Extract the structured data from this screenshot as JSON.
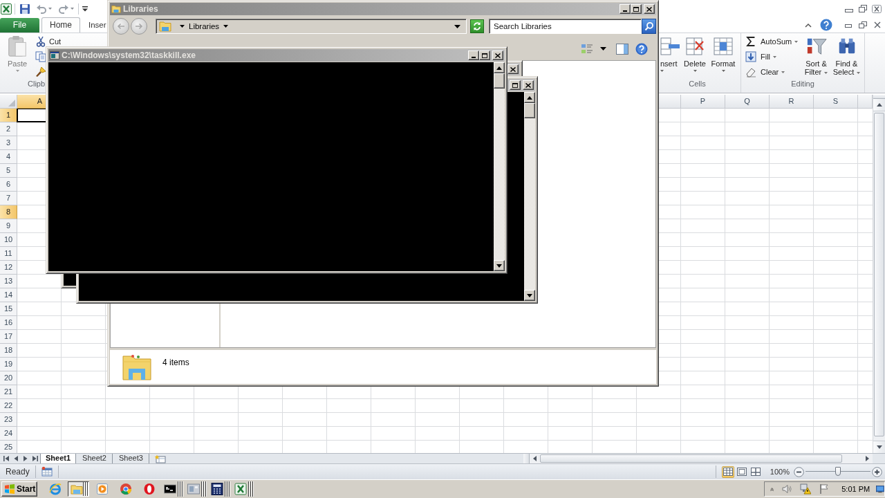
{
  "excel": {
    "ribbon_tabs": [
      {
        "label": "File",
        "kind": "backstage",
        "selected": false
      },
      {
        "label": "Home",
        "kind": "tab",
        "selected": true
      },
      {
        "label": "Inser",
        "kind": "tab",
        "selected": false
      }
    ],
    "clipboard_group": {
      "paste": "Paste",
      "cut": "Cut",
      "label": "Clipb"
    },
    "cells_group": {
      "buttons": [
        "nsert",
        "Delete",
        "Format"
      ],
      "label": "Cells"
    },
    "editing_group": {
      "small_buttons": [
        "AutoSum",
        "Fill",
        "Clear"
      ],
      "large_buttons": [
        "Sort & Filter",
        "Find & Select"
      ],
      "label": "Editing"
    },
    "columns_left": [
      {
        "label": "A",
        "selected": true
      }
    ],
    "columns_right": [
      {
        "label": "P",
        "selected": false
      },
      {
        "label": "Q",
        "selected": false
      },
      {
        "label": "R",
        "selected": false
      },
      {
        "label": "S",
        "selected": false
      }
    ],
    "rows": [
      {
        "label": "1",
        "selected": true
      },
      {
        "label": "2",
        "selected": false
      },
      {
        "label": "3",
        "selected": false
      },
      {
        "label": "4",
        "selected": false
      },
      {
        "label": "5",
        "selected": false
      },
      {
        "label": "6",
        "selected": false
      },
      {
        "label": "7",
        "selected": false
      },
      {
        "label": "8",
        "selected": true
      },
      {
        "label": "9",
        "selected": false
      },
      {
        "label": "10",
        "selected": false
      },
      {
        "label": "11",
        "selected": false
      },
      {
        "label": "12",
        "selected": false
      },
      {
        "label": "13",
        "selected": false
      },
      {
        "label": "14",
        "selected": false
      },
      {
        "label": "15",
        "selected": false
      },
      {
        "label": "16",
        "selected": false
      },
      {
        "label": "17",
        "selected": false
      },
      {
        "label": "18",
        "selected": false
      },
      {
        "label": "19",
        "selected": false
      },
      {
        "label": "20",
        "selected": false
      },
      {
        "label": "21",
        "selected": false
      },
      {
        "label": "22",
        "selected": false
      },
      {
        "label": "23",
        "selected": false
      },
      {
        "label": "24",
        "selected": false
      },
      {
        "label": "25",
        "selected": false
      }
    ],
    "sheet_tabs": [
      {
        "label": "Sheet1",
        "selected": true
      },
      {
        "label": "Sheet2",
        "selected": false
      },
      {
        "label": "Sheet3",
        "selected": false
      }
    ],
    "status": "Ready",
    "views": [
      {
        "kind": "normal",
        "selected": true
      },
      {
        "kind": "page_layout",
        "selected": false
      },
      {
        "kind": "page_break_preview",
        "selected": false
      }
    ],
    "zoom": {
      "reading": "100%",
      "level": 0.5
    }
  },
  "windows": [
    {
      "kind": "explorer",
      "title": "Libraries",
      "breadcrumb": "Libraries",
      "search": {
        "placeholder": "Search Libraries"
      },
      "details": "4 items"
    },
    {
      "kind": "console"
    },
    {
      "kind": "console"
    },
    {
      "kind": "console",
      "title": "C:\\Windows\\system32\\taskkill.exe"
    }
  ],
  "taskbar": {
    "start": "Start",
    "apps": [
      {
        "kind": "ie",
        "selected": false,
        "stacked": false
      },
      {
        "kind": "explorer",
        "selected": true,
        "stacked": true
      },
      {
        "kind": "media",
        "selected": false,
        "stacked": false
      },
      {
        "kind": "chrome",
        "selected": false,
        "stacked": false
      },
      {
        "kind": "opera",
        "selected": false,
        "stacked": false
      },
      {
        "kind": "console",
        "selected": false,
        "stacked": true
      },
      {
        "kind": "window",
        "selected": false,
        "stacked": true
      },
      {
        "kind": "calculator",
        "selected": false,
        "stacked": true
      },
      {
        "kind": "excel",
        "selected": false,
        "stacked": true
      }
    ],
    "clock": "5:01 PM"
  }
}
